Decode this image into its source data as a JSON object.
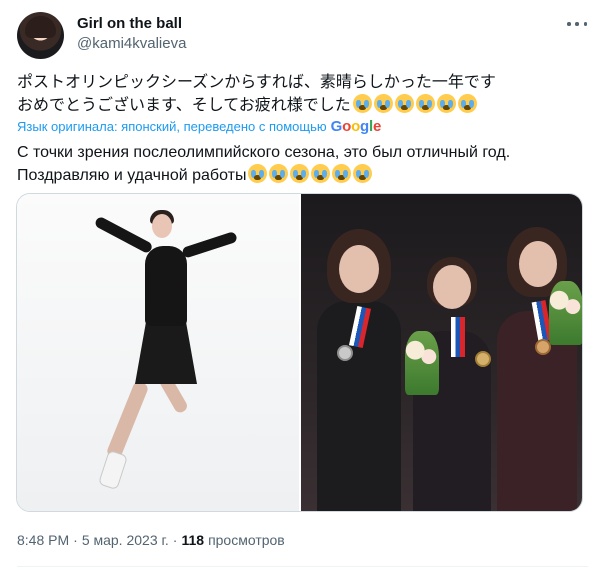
{
  "author": {
    "name": "Girl on the ball",
    "handle": "@kami4kvalieva"
  },
  "tweet": {
    "text_jp_line1": "ポストオリンピックシーズンからすれば、素晴らしかった一年です",
    "text_jp_line2": "おめでとうございます、そしてお疲れ様でした",
    "translation_note": "Язык оригинала: японский, переведено с помощью",
    "translation_provider": "Google",
    "text_ru_line1": "С точки зрения послеолимпийского сезона, это был отличный год.",
    "text_ru_line2": "Поздравляю и удачной работы",
    "emoji_name": "loudly-crying-face",
    "emoji_count": 6
  },
  "media": {
    "left_photo": "figure-skater-black-dress",
    "right_photo": "medalists-podium-with-flowers"
  },
  "meta": {
    "time": "8:48 PM",
    "separator": "·",
    "date": "5 мар. 2023 г.",
    "views_count": "118",
    "views_label": "просмотров"
  },
  "colors": {
    "text": "#0f1419",
    "secondary": "#536471",
    "link": "#1d9bf0",
    "border": "#cfd9de"
  }
}
